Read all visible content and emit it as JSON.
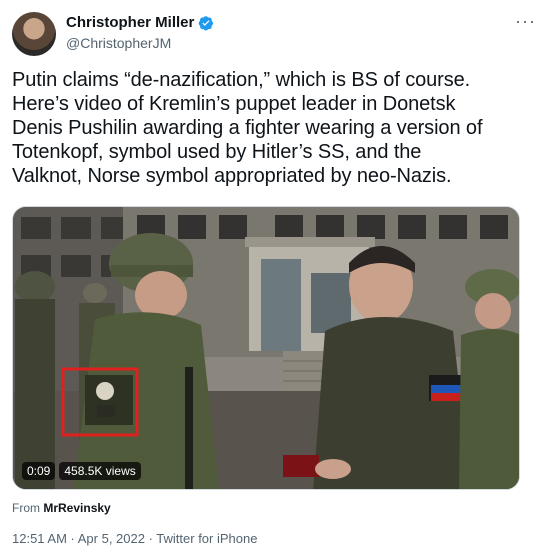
{
  "author": {
    "name": "Christopher Miller",
    "handle": "@ChristopherJM",
    "verified": true,
    "more_menu_icon": "ellipsis-icon"
  },
  "tweet": {
    "text": "Putin claims “de-nazification,” which is BS of course.\nHere’s video of Kremlin’s puppet leader in Donetsk\nDenis Pushilin awarding a fighter wearing a version of\nTotenkopf, symbol used by Hitler’s SS, and the\nValknot, Norse symbol appropriated by neo-Nazis."
  },
  "video": {
    "duration": "0:09",
    "views": "458.5K views",
    "highlight_color": "#e0201e"
  },
  "source": {
    "prefix": "From",
    "name": "MrRevinsky"
  },
  "meta": {
    "timestamp": "12:51 AM · Apr 5, 2022 · Twitter for iPhone"
  },
  "colors": {
    "verified_blue": "#1d9bf0",
    "secondary_text": "#536471"
  }
}
